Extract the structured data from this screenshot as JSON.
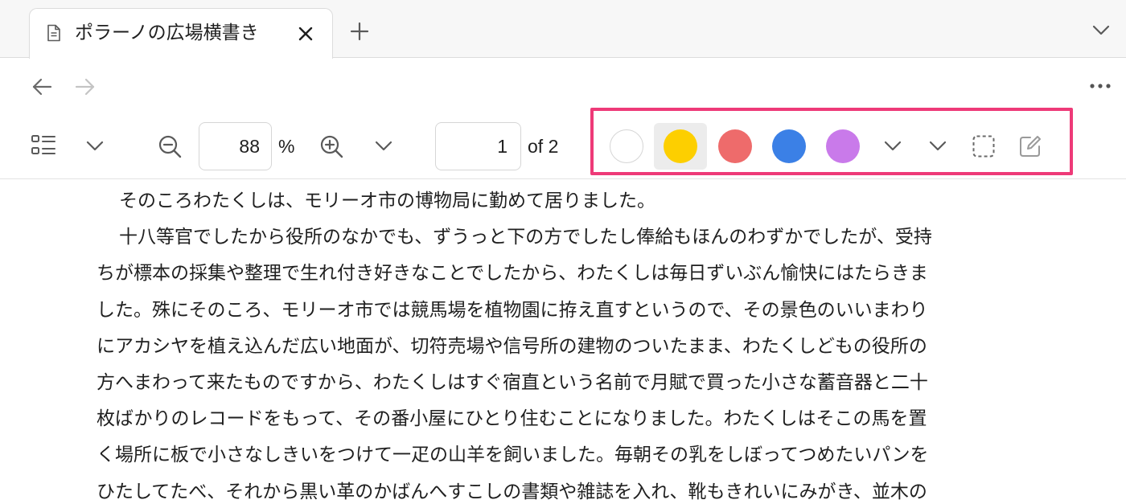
{
  "tab": {
    "title": "ポラーノの広場横書き",
    "doc_icon": "document-icon",
    "close_icon": "close-icon"
  },
  "tabstrip": {
    "new_tab_icon": "plus-icon",
    "tab_list_icon": "chevron-down-icon"
  },
  "nav": {
    "back_icon": "arrow-left-icon",
    "forward_icon": "arrow-right-icon",
    "forward_enabled": false,
    "more_icon": "ellipsis-icon"
  },
  "toolbar": {
    "sidebar_icon": "sidebar-list-icon",
    "zoom_value": "88",
    "zoom_unit": "%",
    "page_current": "1",
    "page_total_label": "of 2",
    "highlight_colors": [
      {
        "name": "white",
        "hex": "#ffffff",
        "selected": false
      },
      {
        "name": "yellow",
        "hex": "#fdcf00",
        "selected": true
      },
      {
        "name": "red",
        "hex": "#ee6b6b",
        "selected": false
      },
      {
        "name": "blue",
        "hex": "#3b80e6",
        "selected": false
      },
      {
        "name": "purple",
        "hex": "#c97aea",
        "selected": false
      }
    ],
    "focus_outline_color": "#ee3a78"
  },
  "document": {
    "lines": [
      "そのころわたくしは、モリーオ市の博物局に勤めて居りました。",
      "十八等官でしたから役所のなかでも、ずうっと下の方でしたし俸給もほんのわずかでしたが、受持",
      "ちが標本の採集や整理で生れ付き好きなことでしたから、わたくしは毎日ずいぶん愉快にはたらきま",
      "した。殊にそのころ、モリーオ市では競馬場を植物園に拵え直すというので、その景色のいいまわり",
      "にアカシヤを植え込んだ広い地面が、切符売場や信号所の建物のついたまま、わたくしどもの役所の",
      "方へまわって来たものですから、わたくしはすぐ宿直という名前で月賦で買った小さな蓄音器と二十",
      "枚ばかりのレコードをもって、その番小屋にひとり住むことになりました。わたくしはそこの馬を置",
      "く場所に板で小さなしきいをつけて一疋の山羊を飼いました。毎朝その乳をしぼってつめたいパンを",
      "ひたしてたべ、それから黒い革のかばんへすこしの書類や雑誌を入れ、靴もきれいにみがき、並木の"
    ]
  }
}
